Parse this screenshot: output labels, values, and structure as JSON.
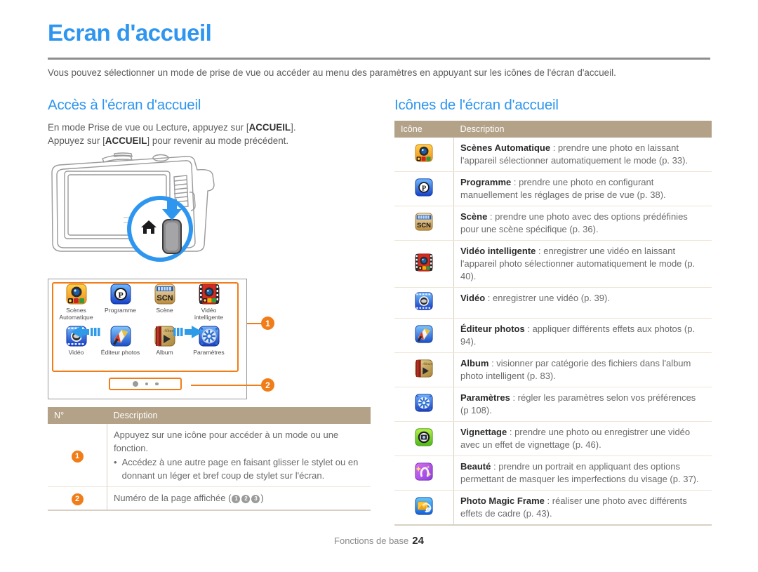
{
  "header": {
    "title": "Ecran d'accueil",
    "intro": "Vous pouvez sélectionner un mode de prise de vue ou accéder au menu des paramètres en appuyant sur les icônes de l'écran d'accueil."
  },
  "left": {
    "heading": "Accès à l'écran d'accueil",
    "line1_pre": "En mode Prise de vue ou Lecture, appuyez sur [",
    "line1_bold": "ACCUEIL",
    "line1_post": "].",
    "line2_pre": "Appuyez sur [",
    "line2_bold": "ACCUEIL",
    "line2_post": "] pour revenir au mode précédent.",
    "screen_grid": [
      {
        "label": "Scènes\nAutomatique",
        "icon": "scenes-auto-icon"
      },
      {
        "label": "Programme",
        "icon": "programme-icon"
      },
      {
        "label": "Scène",
        "icon": "scene-icon"
      },
      {
        "label": "Vidéo\nintelligente",
        "icon": "smart-video-icon"
      },
      {
        "label": "Vidéo",
        "icon": "video-icon"
      },
      {
        "label": "Éditeur photos",
        "icon": "photo-editor-icon"
      },
      {
        "label": "Album",
        "icon": "album-icon"
      },
      {
        "label": "Paramètres",
        "icon": "settings-icon"
      }
    ],
    "callouts": {
      "one": "1",
      "two": "2"
    },
    "table": {
      "headers": [
        "N°",
        "Description"
      ],
      "rows": [
        {
          "num": "1",
          "text": "Appuyez sur une icône pour accéder à un mode ou une fonction.",
          "bullet_mark": "•",
          "bullet": "Accédez à une autre page en faisant glisser le stylet ou en donnant un léger et bref coup de stylet sur l'écran."
        },
        {
          "num": "2",
          "text_pre": "Numéro de la page affichée (",
          "marks": [
            "1",
            "2",
            "3"
          ],
          "text_post": ")"
        }
      ]
    }
  },
  "right": {
    "heading": "Icônes de l'écran d'accueil",
    "table": {
      "headers": [
        "Icône",
        "Description"
      ],
      "rows": [
        {
          "icon": "scenes-auto-icon",
          "name": "Scènes Automatique",
          "sep": " : ",
          "desc": "prendre une photo en laissant l'appareil sélectionner automatiquement le mode (p. 33)."
        },
        {
          "icon": "programme-icon",
          "name": "Programme",
          "sep": " : ",
          "desc": "prendre une photo en configurant manuellement les réglages de prise de vue (p. 38)."
        },
        {
          "icon": "scene-icon",
          "name": "Scène",
          "sep": " : ",
          "desc": "prendre une photo avec des options prédéfinies pour une scène spécifique (p. 36)."
        },
        {
          "icon": "smart-video-icon",
          "name": "Vidéo intelligente",
          "sep": " : ",
          "desc": "enregistrer une vidéo en laissant l'appareil photo sélectionner automatiquement le mode (p. 40)."
        },
        {
          "icon": "video-icon",
          "name": "Vidéo",
          "sep": " : ",
          "desc": "enregistrer une vidéo (p. 39)."
        },
        {
          "icon": "photo-editor-icon",
          "name": "Éditeur photos",
          "sep": " : ",
          "desc": "appliquer différents effets aux photos (p. 94)."
        },
        {
          "icon": "album-icon",
          "name": "Album",
          "sep": "  : ",
          "desc": "visionner par catégorie des fichiers dans l'album photo intelligent (p. 83)."
        },
        {
          "icon": "settings-icon",
          "name": "Paramètres",
          "sep": " : ",
          "desc": "régler les paramètres selon vos préférences (p 108)."
        },
        {
          "icon": "vignette-icon",
          "name": "Vignettage",
          "sep": " : ",
          "desc": "prendre une photo ou enregistrer une vidéo avec un effet de vignettage (p. 46)."
        },
        {
          "icon": "beauty-icon",
          "name": "Beauté",
          "sep": " : ",
          "desc": "prendre un portrait en appliquant des options permettant de masquer les imperfections du visage (p. 37)."
        },
        {
          "icon": "magic-frame-icon",
          "name": "Photo Magic Frame",
          "sep": " : ",
          "desc": "réaliser une photo avec différents effets de cadre (p. 43)."
        }
      ]
    }
  },
  "footer": {
    "section": "Fonctions de base",
    "page": "24"
  },
  "colors": {
    "accent_blue": "#2f96f0",
    "callout_orange": "#f07d18",
    "table_header": "#b3a288",
    "body_text": "#5b5b5d"
  }
}
